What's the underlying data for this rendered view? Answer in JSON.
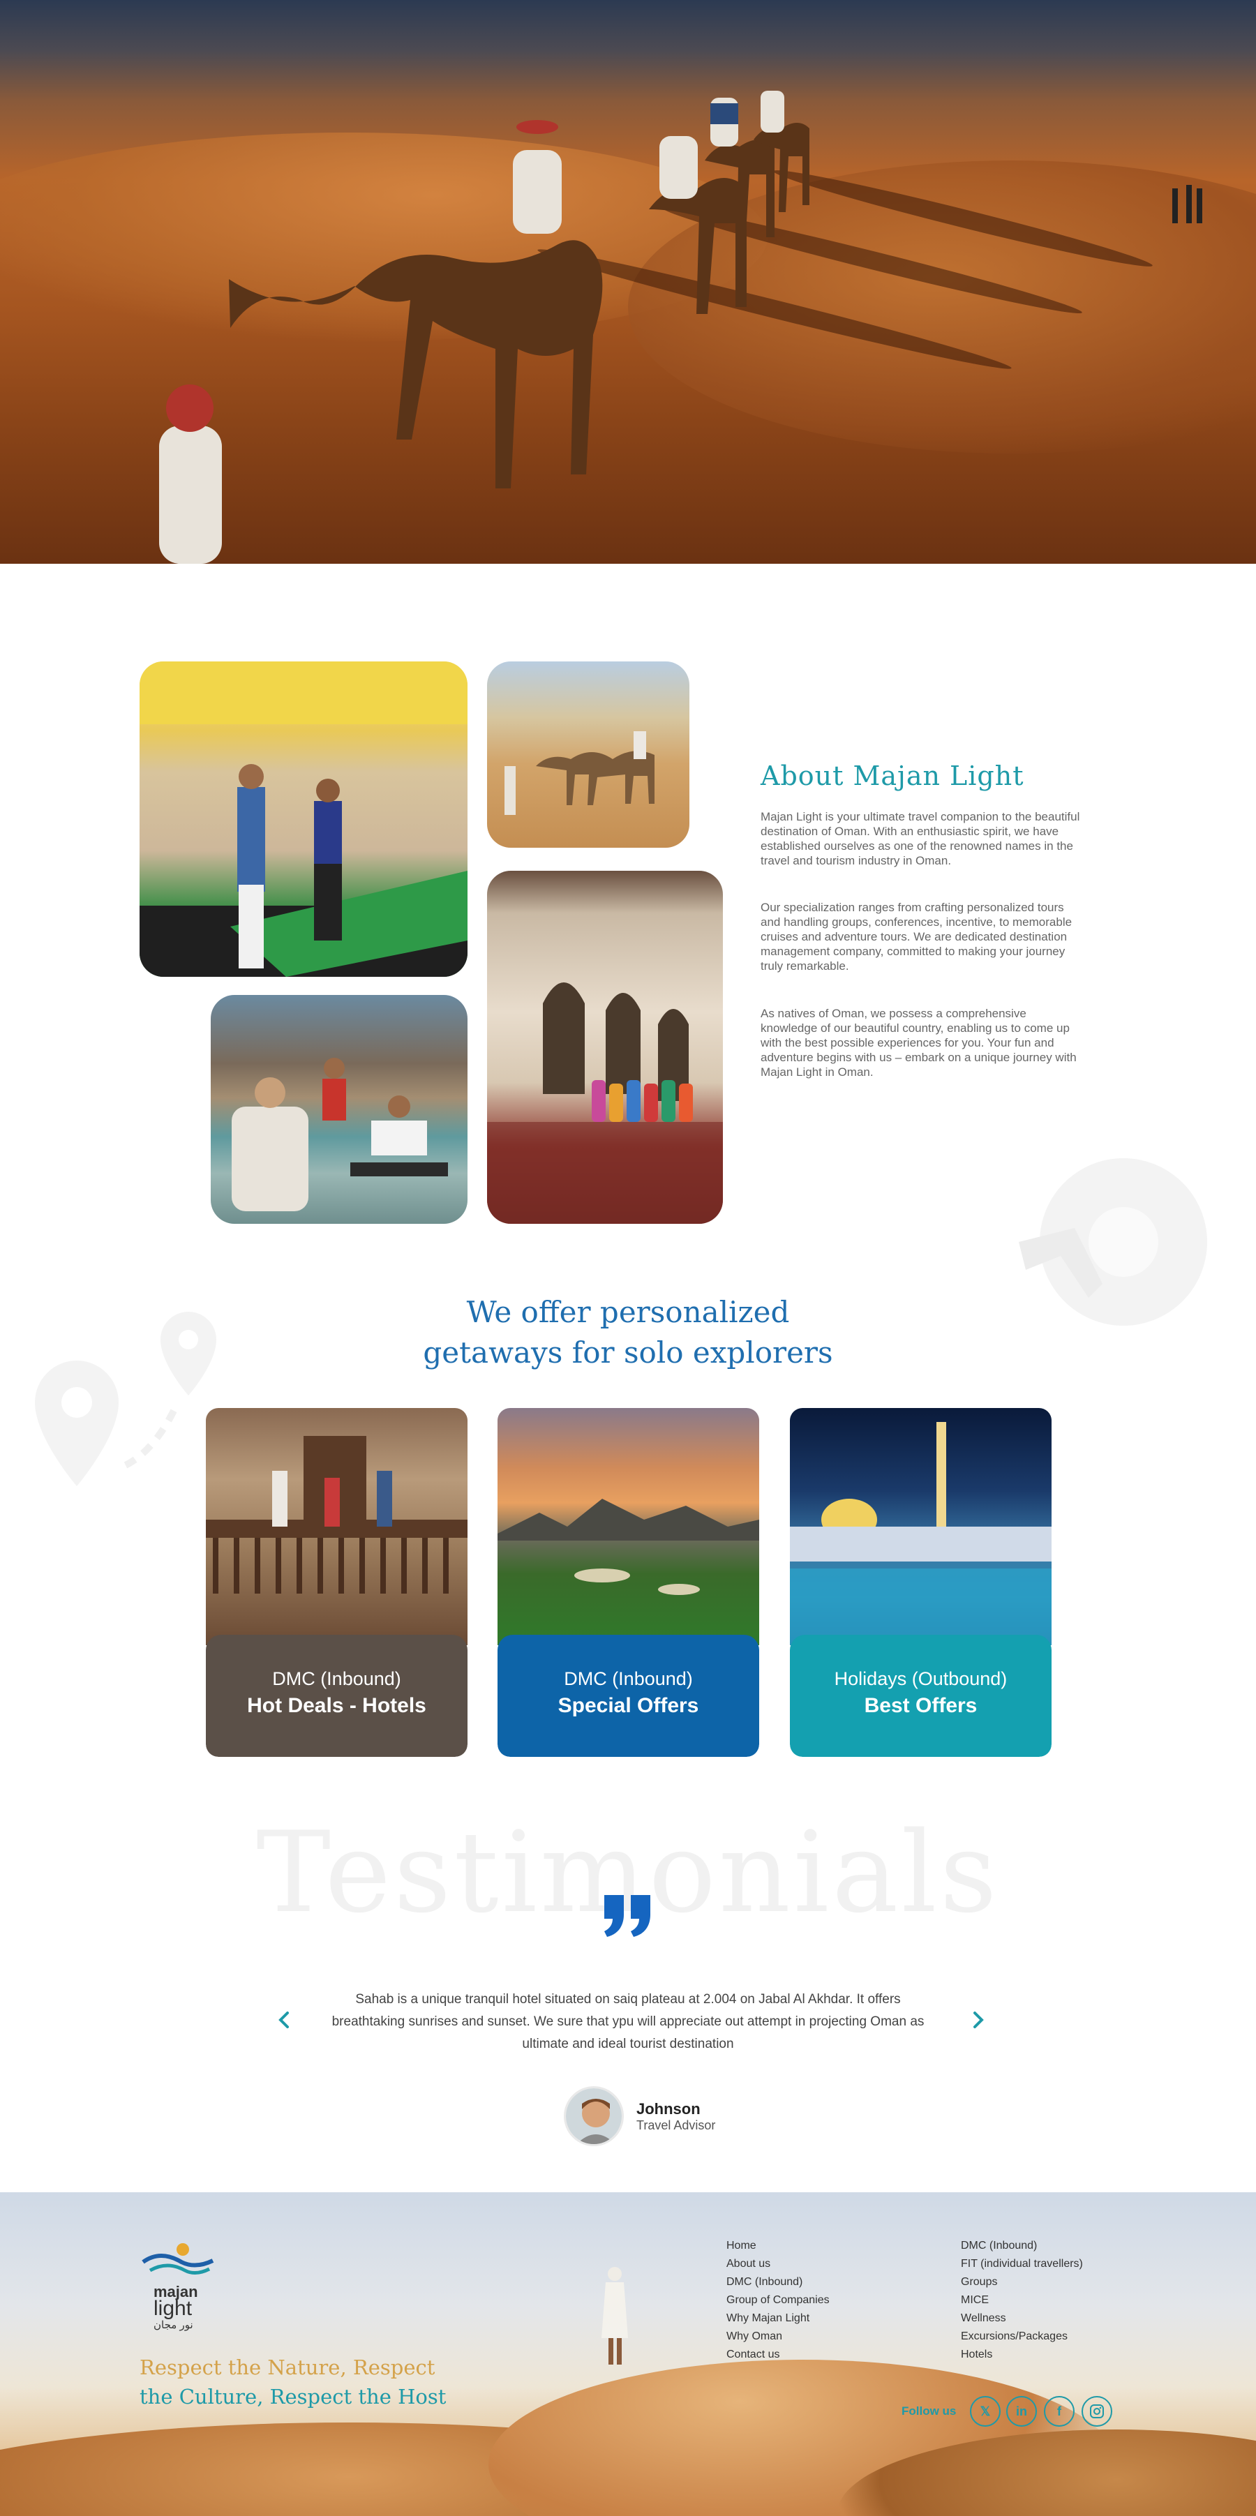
{
  "about": {
    "title": "About Majan Light",
    "paragraphs": [
      "Majan Light is your ultimate travel companion to the beautiful destination of Oman. With an enthusiastic spirit, we have established ourselves as one of the renowned names in the travel and tourism industry in Oman.",
      "Our specialization ranges from crafting personalized tours and handling groups, conferences, incentive, to memorable cruises and adventure tours. We are dedicated destination management company, committed to making your journey truly remarkable.",
      "As natives of Oman, we possess a comprehensive knowledge of our beautiful country, enabling us to come up with the best possible experiences for you. Your fun and adventure begins with us – embark on a unique journey with Majan Light in Oman."
    ]
  },
  "offers": {
    "title_line1": "We offer personalized",
    "title_line2": "getaways for solo explorers",
    "cards": [
      {
        "line1": "DMC (Inbound)",
        "line2": "Hot Deals - Hotels",
        "color": "#5b5048"
      },
      {
        "line1": "DMC (Inbound)",
        "line2": "Special Offers",
        "color": "#0d64a8"
      },
      {
        "line1": "Holidays (Outbound)",
        "line2": "Best Offers",
        "color": "#14a0b0"
      }
    ]
  },
  "testimonials": {
    "heading": "Testimonials",
    "text": "Sahab is a unique tranquil hotel situated on saiq plateau at 2.004 on Jabal Al Akhdar. It offers breathtaking sunrises and sunset. We sure that ypu will appreciate out attempt in projecting Oman as ultimate and ideal tourist destination",
    "name": "Johnson",
    "role": "Travel Advisor"
  },
  "footer": {
    "logo_line1": "majan",
    "logo_line2": "light",
    "logo_arabic": "نور مجان",
    "tagline_1": "Respect the Nature, Respect",
    "tagline_2": "the Culture, Respect the Host",
    "links_col1": [
      "Home",
      "About us",
      "DMC (Inbound)",
      "Group of Companies",
      "Why Majan Light",
      "Why Oman",
      "Contact us"
    ],
    "links_col2": [
      "DMC (Inbound)",
      "FIT (individual travellers)",
      "Groups",
      "MICE",
      "Wellness",
      "Excursions/Packages",
      "Hotels"
    ],
    "follow_label": "Follow us"
  },
  "colors": {
    "teal": "#1e9aa8",
    "blue": "#1f6eaf",
    "gold": "#d4a24a"
  },
  "icons": [
    "chevron-left-icon",
    "chevron-right-icon",
    "quote-icon",
    "x-icon",
    "linkedin-icon",
    "facebook-icon",
    "instagram-icon",
    "map-pin-icon"
  ]
}
